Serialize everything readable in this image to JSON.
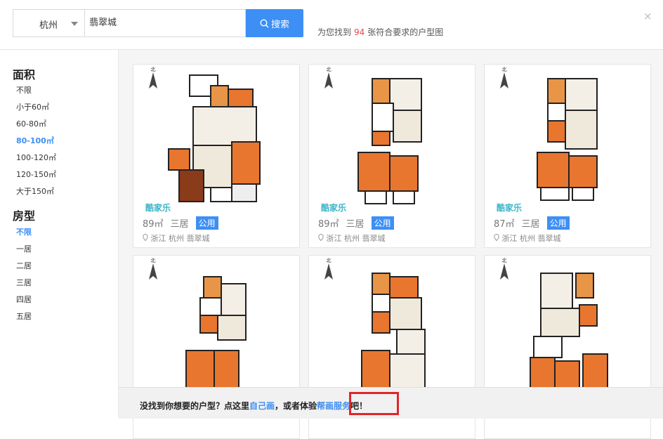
{
  "search": {
    "city": "杭州",
    "query": "翡翠城",
    "button_label": "搜索"
  },
  "result": {
    "prefix": "为您找到",
    "count": "94",
    "suffix": "张符合要求的户型图"
  },
  "close_label": "×",
  "filters": {
    "area": {
      "title": "面积",
      "options": [
        "不限",
        "小于60㎡",
        "60-80㎡",
        "80-100㎡",
        "100-120㎡",
        "120-150㎡",
        "大于150㎡"
      ],
      "selected": "80-100㎡"
    },
    "layout": {
      "title": "房型",
      "options": [
        "不限",
        "一居",
        "二居",
        "三居",
        "四居",
        "五居"
      ],
      "selected": "不限"
    }
  },
  "cards": [
    {
      "logo": "酷家乐",
      "area": "89㎡",
      "rooms": "三居",
      "badge": "公用",
      "location": "浙江 杭州   翡翠城"
    },
    {
      "logo": "酷家乐",
      "area": "89㎡",
      "rooms": "三居",
      "badge": "公用",
      "location": "浙江 杭州   翡翠城"
    },
    {
      "logo": "酷家乐",
      "area": "87㎡",
      "rooms": "三居",
      "badge": "公用",
      "location": "浙江 杭州   翡翠城"
    },
    {},
    {},
    {}
  ],
  "banner": {
    "text1": "没找到你想要的户型？点这里",
    "link1": "自己画",
    "text2": "，或者体验",
    "link2": "帮画服务",
    "text3": "吧！"
  },
  "colors": {
    "accent": "#3d8ff5",
    "count_red": "#e94a4a",
    "highlight_box": "#e0262b",
    "logo_teal": "#3cb5c8"
  }
}
